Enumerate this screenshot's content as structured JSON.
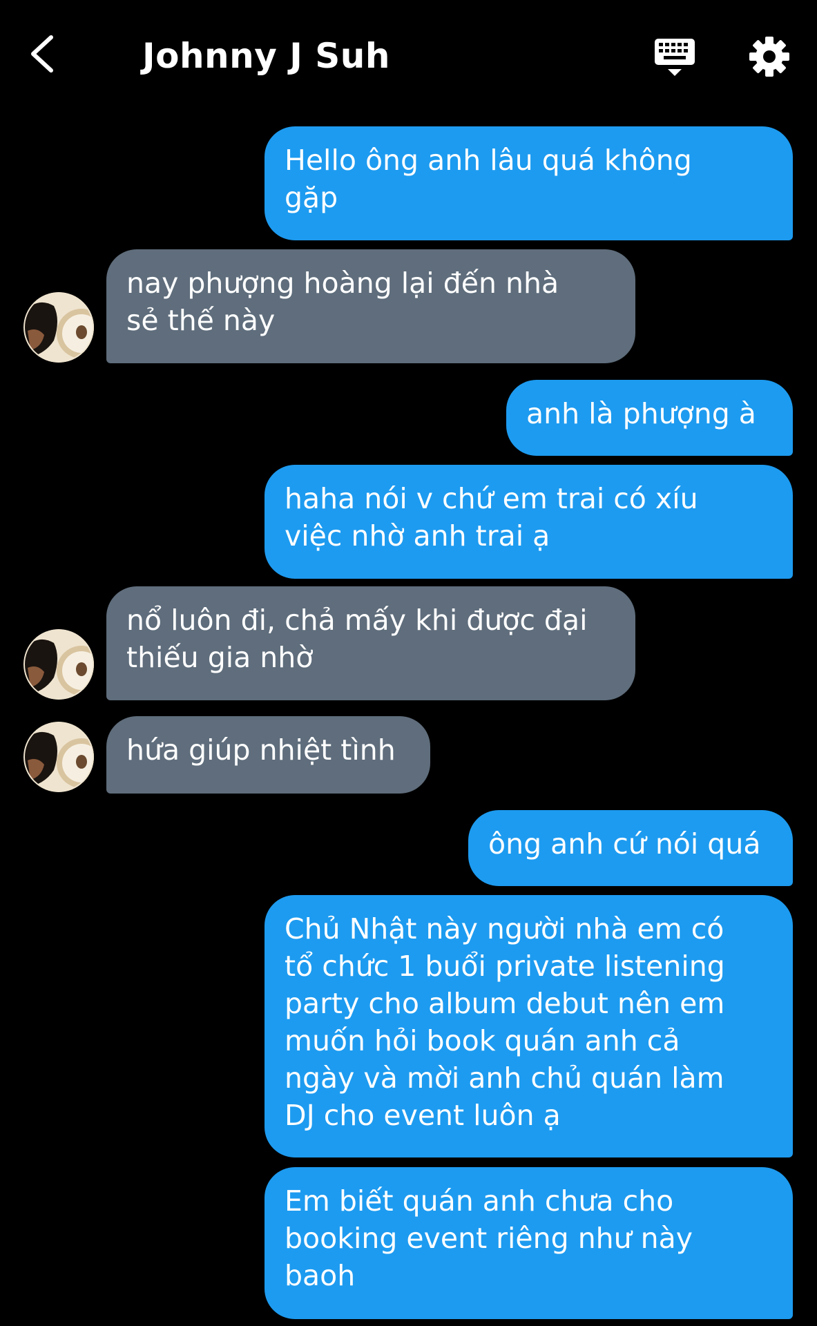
{
  "header": {
    "title": "Johnny J Suh",
    "back_icon": "chevron-left-icon",
    "keyboard_icon": "keyboard-icon",
    "settings_icon": "gear-icon"
  },
  "colors": {
    "background": "#000000",
    "outgoing_bubble": "#1d9bf0",
    "incoming_bubble": "#5f6d7c",
    "text": "#ffffff"
  },
  "messages": [
    {
      "side": "out",
      "text": "Hello ông anh lâu quá không\ngặp"
    },
    {
      "side": "in",
      "text": "nay phượng hoàng lại đến nhà\nsẻ thế này"
    },
    {
      "side": "out",
      "text": "anh là phượng à"
    },
    {
      "side": "out",
      "text": "haha nói v chứ em trai có xíu\nviệc nhờ anh trai ạ"
    },
    {
      "side": "in",
      "text": "nổ luôn đi, chả mấy khi được đại\nthiếu gia nhờ"
    },
    {
      "side": "in",
      "text": "hứa giúp nhiệt tình"
    },
    {
      "side": "out",
      "text": "ông anh cứ nói quá"
    },
    {
      "side": "out",
      "text": "Chủ Nhật này người nhà em có\ntổ chức 1 buổi private listening\nparty cho album debut nên em\nmuốn hỏi book quán anh cả\nngày và mời anh chủ quán làm\nDJ cho event luôn ạ"
    },
    {
      "side": "out",
      "text": "Em biết quán anh chưa cho\nbooking event riêng như này\nbaoh"
    }
  ]
}
